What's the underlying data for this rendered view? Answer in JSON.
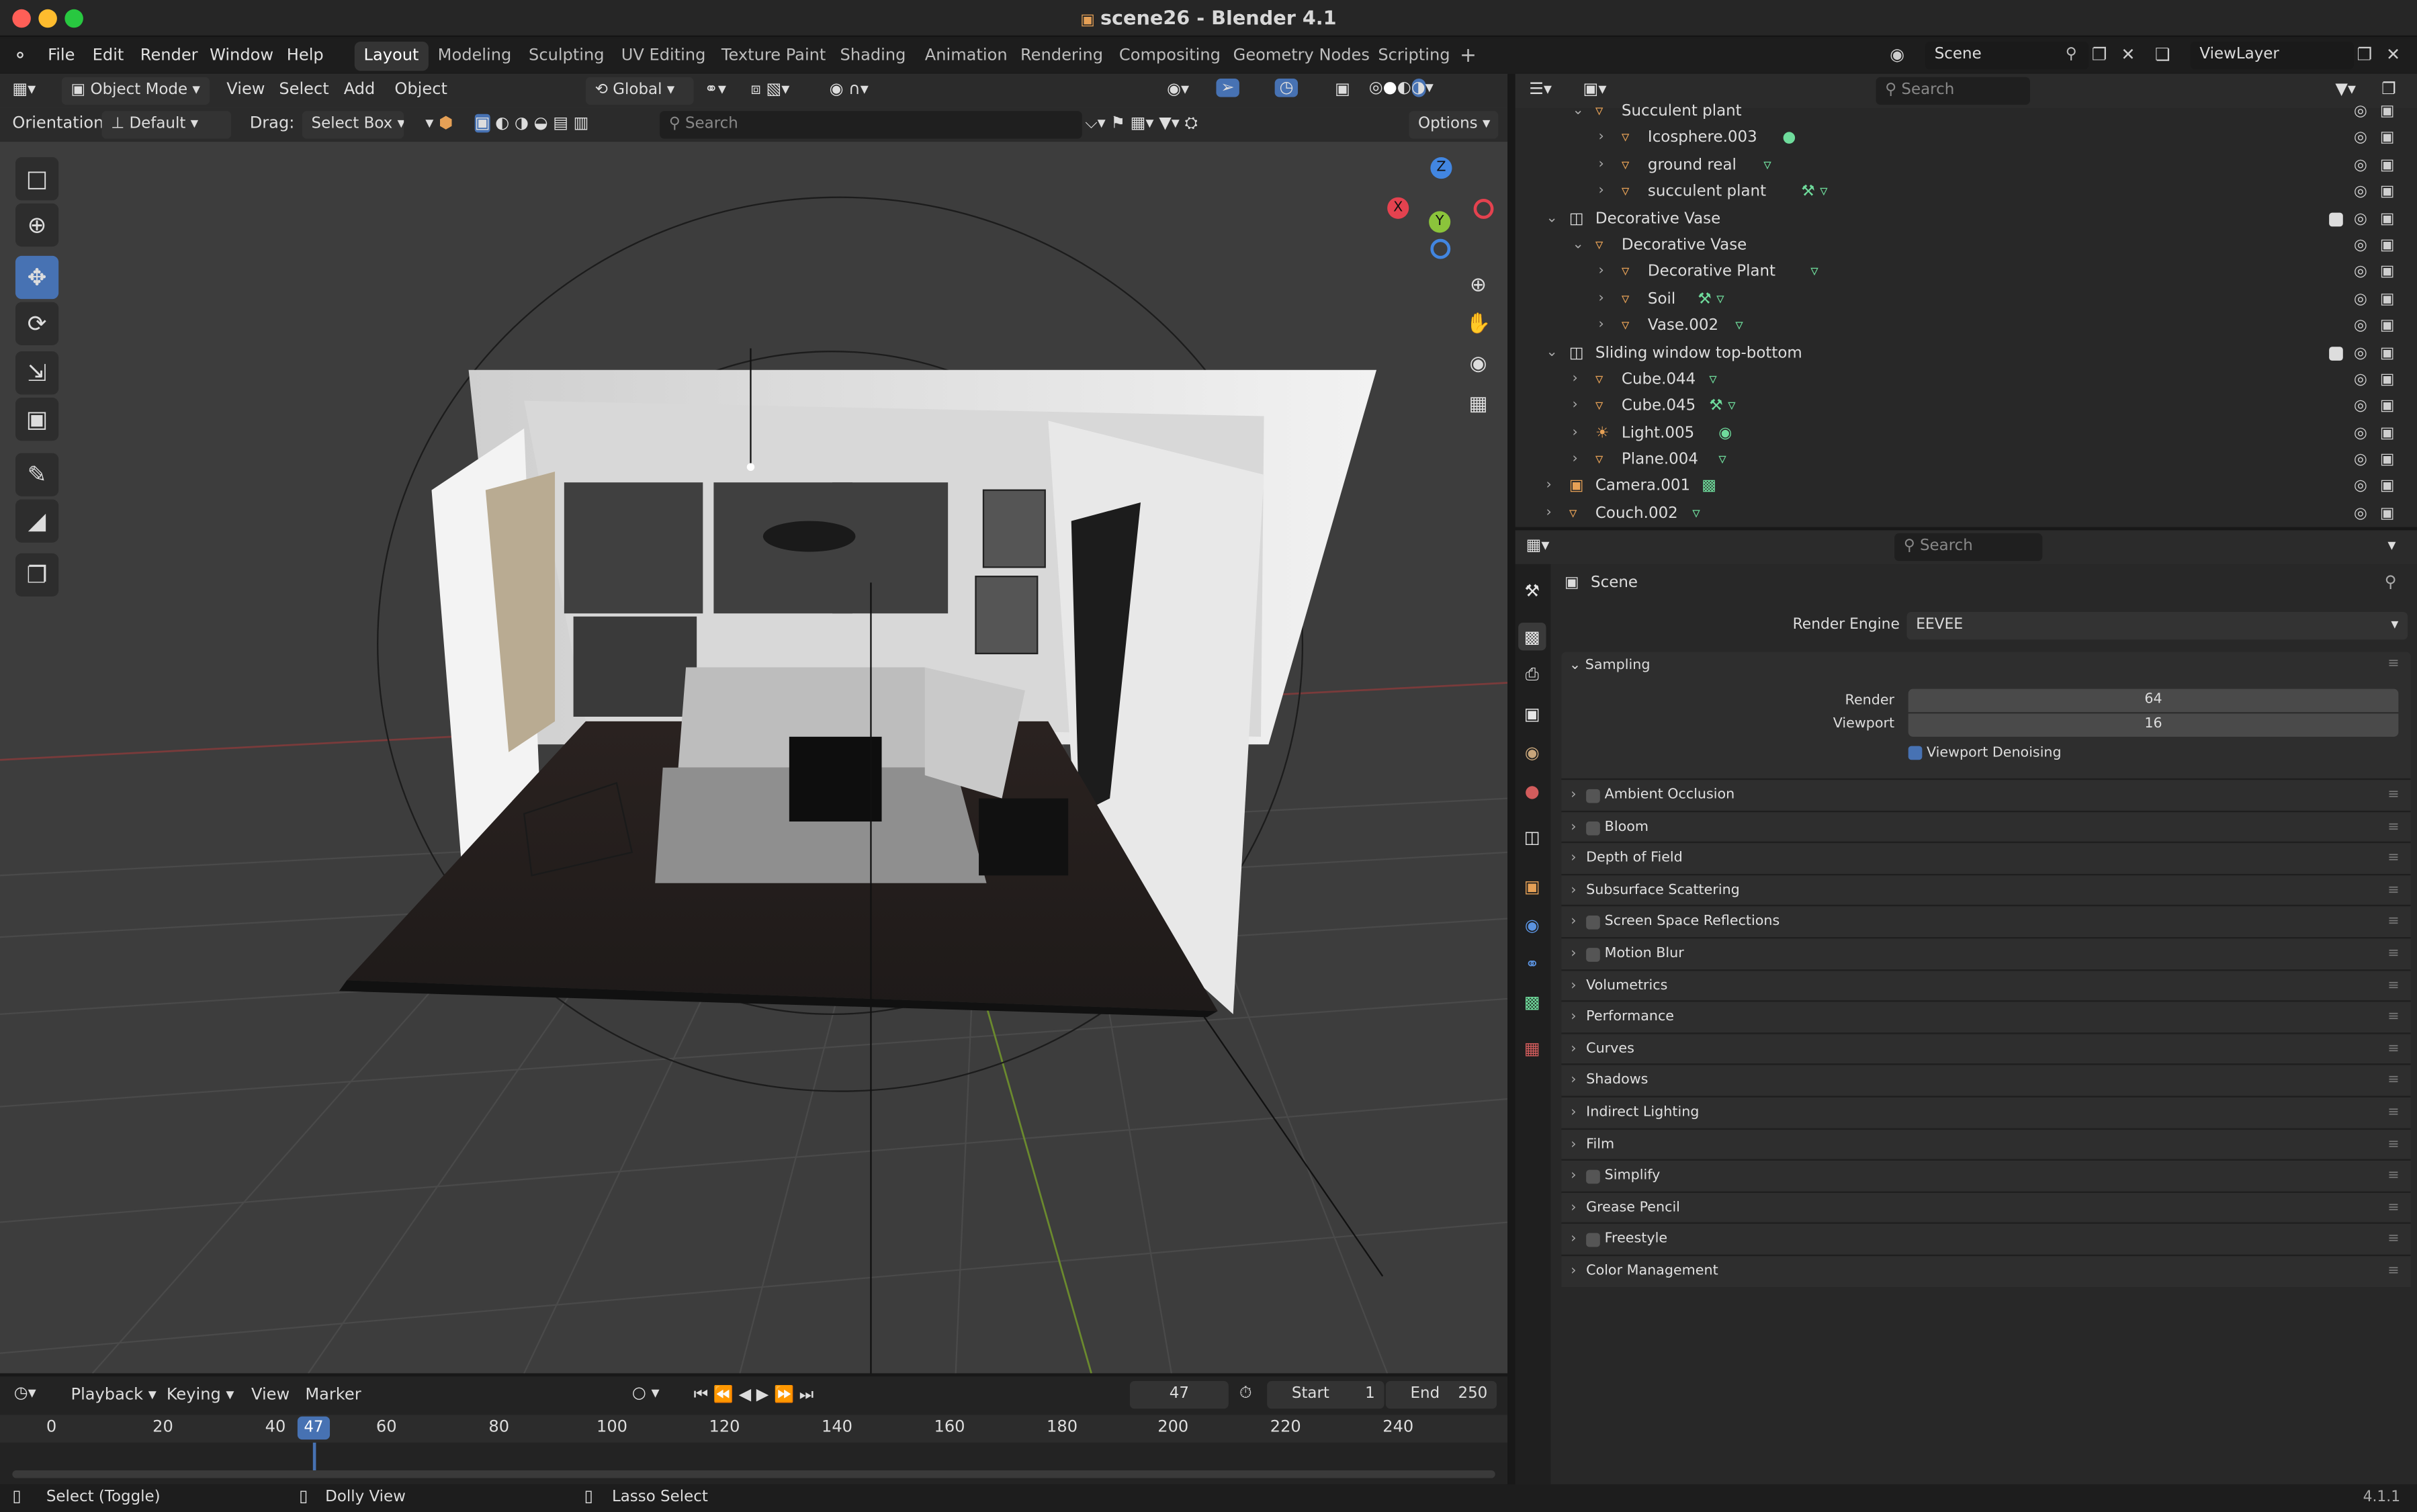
{
  "window": {
    "title": "scene26 - Blender 4.1",
    "doc_icon": "document-icon"
  },
  "menu": {
    "items": [
      "File",
      "Edit",
      "Render",
      "Window",
      "Help"
    ],
    "workspaces": [
      "Layout",
      "Modeling",
      "Sculpting",
      "UV Editing",
      "Texture Paint",
      "Shading",
      "Animation",
      "Rendering",
      "Compositing",
      "Geometry Nodes",
      "Scripting"
    ],
    "active_workspace": "Layout",
    "add_tab": "+",
    "scene": "Scene",
    "view_layer": "ViewLayer"
  },
  "viewport": {
    "mode": "Object Mode",
    "menus": [
      "View",
      "Select",
      "Add",
      "Object"
    ],
    "transform": "Global",
    "orientation_label": "Orientation:",
    "orientation_value": "Default",
    "drag_label": "Drag:",
    "drag_value": "Select Box",
    "search_placeholder": "Search",
    "options": "Options",
    "gizmo": {
      "x": "X",
      "y": "Y",
      "z": "Z"
    }
  },
  "outliner": {
    "search_placeholder": "Search",
    "rows": [
      {
        "name": "Succulent plant",
        "indent": 2,
        "icon": "empty"
      },
      {
        "name": "Icosphere.003",
        "indent": 3,
        "icon": "mesh"
      },
      {
        "name": "ground real",
        "indent": 3,
        "icon": "mesh"
      },
      {
        "name": "succulent plant",
        "indent": 3,
        "icon": "mesh"
      },
      {
        "name": "Decorative Vase",
        "indent": 1,
        "icon": "collection"
      },
      {
        "name": "Decorative Vase",
        "indent": 2,
        "icon": "empty"
      },
      {
        "name": "Decorative Plant",
        "indent": 3,
        "icon": "mesh"
      },
      {
        "name": "Soil",
        "indent": 3,
        "icon": "mesh"
      },
      {
        "name": "Vase.002",
        "indent": 3,
        "icon": "mesh"
      },
      {
        "name": "Sliding window top-bottom",
        "indent": 1,
        "icon": "collection"
      },
      {
        "name": "Cube.044",
        "indent": 2,
        "icon": "mesh"
      },
      {
        "name": "Cube.045",
        "indent": 2,
        "icon": "mesh"
      },
      {
        "name": "Light.005",
        "indent": 2,
        "icon": "light"
      },
      {
        "name": "Plane.004",
        "indent": 2,
        "icon": "mesh"
      },
      {
        "name": "Camera.001",
        "indent": 1,
        "icon": "camera"
      },
      {
        "name": "Couch.002",
        "indent": 1,
        "icon": "empty"
      }
    ]
  },
  "properties": {
    "search_placeholder": "Search",
    "context": "Scene",
    "render_engine_label": "Render Engine",
    "render_engine": "EEVEE",
    "sampling": {
      "title": "Sampling",
      "render_label": "Render",
      "render": "64",
      "viewport_label": "Viewport",
      "viewport": "16",
      "denoise_label": "Viewport Denoising",
      "denoise": true
    },
    "panels": [
      {
        "name": "Ambient Occlusion",
        "check": true
      },
      {
        "name": "Bloom",
        "check": true
      },
      {
        "name": "Depth of Field",
        "check": false
      },
      {
        "name": "Subsurface Scattering",
        "check": false
      },
      {
        "name": "Screen Space Reflections",
        "check": true
      },
      {
        "name": "Motion Blur",
        "check": true
      },
      {
        "name": "Volumetrics",
        "check": false
      },
      {
        "name": "Performance",
        "check": false
      },
      {
        "name": "Curves",
        "check": false
      },
      {
        "name": "Shadows",
        "check": false
      },
      {
        "name": "Indirect Lighting",
        "check": false
      },
      {
        "name": "Film",
        "check": false
      },
      {
        "name": "Simplify",
        "check": true
      },
      {
        "name": "Grease Pencil",
        "check": false
      },
      {
        "name": "Freestyle",
        "check": true
      },
      {
        "name": "Color Management",
        "check": false
      }
    ]
  },
  "timeline": {
    "menus": [
      "Playback",
      "Keying",
      "View",
      "Marker"
    ],
    "current_frame": "47",
    "start_label": "Start",
    "start": "1",
    "end_label": "End",
    "end": "250",
    "ruler": [
      "0",
      "20",
      "40",
      "60",
      "80",
      "100",
      "120",
      "140",
      "160",
      "180",
      "200",
      "220",
      "240"
    ]
  },
  "status": {
    "select": "Select (Toggle)",
    "dolly": "Dolly View",
    "lasso": "Lasso Select",
    "version": "4.1.1"
  },
  "colors": {
    "accent": "#4772b3",
    "mesh_icon": "#e5a056",
    "data_icon": "#6fdc9c",
    "x_axis": "#e4424f",
    "y_axis": "#8bc43b",
    "z_axis": "#4286e1"
  }
}
